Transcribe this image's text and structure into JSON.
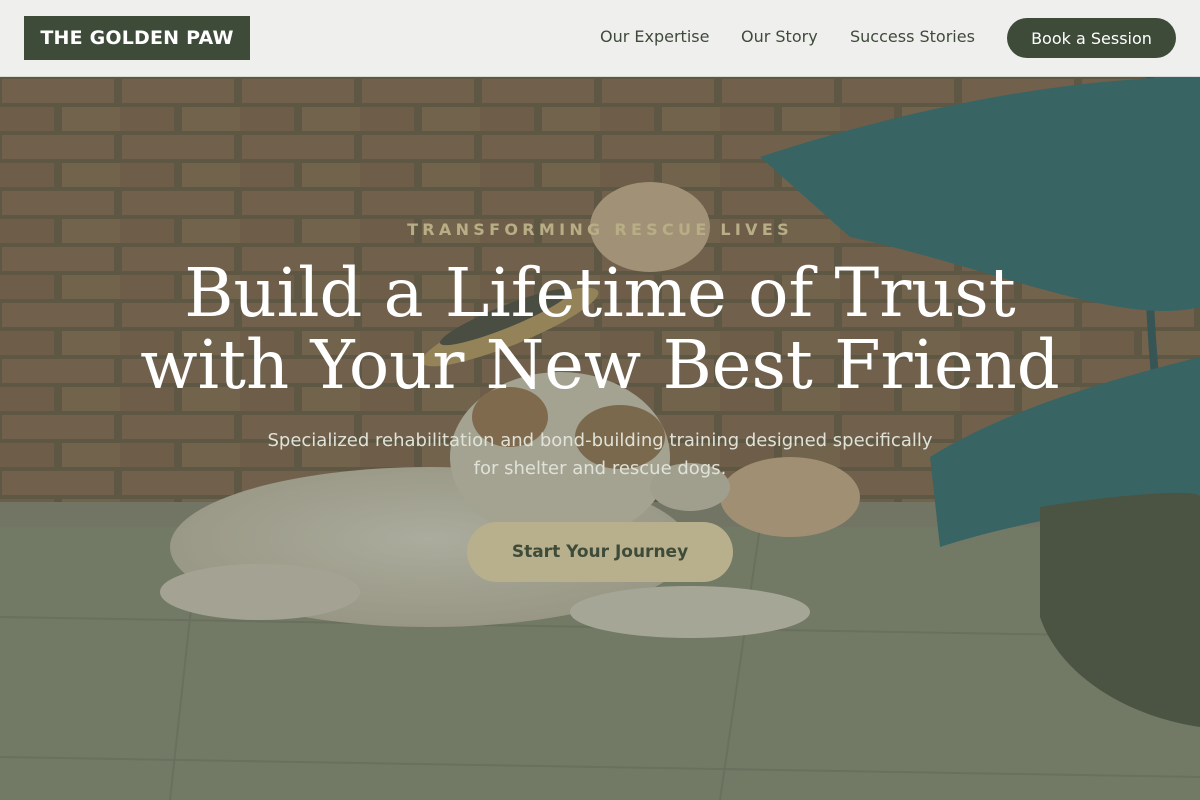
{
  "header": {
    "logo": "THE GOLDEN PAW",
    "nav": [
      "Our Expertise",
      "Our Story",
      "Success Stories"
    ],
    "cta": "Book a Session"
  },
  "hero": {
    "eyebrow": "TRANSFORMING RESCUE LIVES",
    "headline_line1": "Build a Lifetime of Trust",
    "headline_line2": "with Your New Best Friend",
    "subtext": "Specialized rehabilitation and bond-building training designed specifically for shelter and rescue dogs.",
    "cta": "Start Your Journey",
    "image_alt": "Person brushing a rescue puppy lying on a tiled floor in front of a brick wall"
  },
  "colors": {
    "brand_dark": "#3e4b39",
    "accent_gold": "#b8b08c",
    "eyebrow": "#b8ae86",
    "header_bg": "#efefee"
  }
}
